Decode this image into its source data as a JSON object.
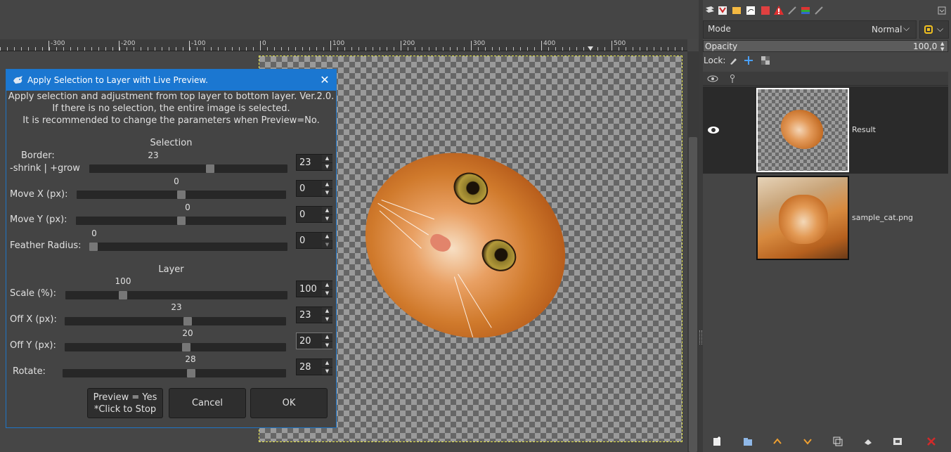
{
  "ruler": {
    "labels": [
      "-300",
      "-200",
      "-100",
      "0",
      "100",
      "200",
      "300",
      "400",
      "500"
    ]
  },
  "dialog": {
    "title": "Apply Selection to Layer with Live Preview.",
    "desc_line1": "Apply selection and adjustment from top layer to bottom layer. Ver.2.0.",
    "desc_line2": "If there is no selection, the entire image is selected.",
    "desc_line3": "It is recommended to change the parameters when Preview=No.",
    "section_selection": "Selection",
    "section_layer": "Layer",
    "params": {
      "border": {
        "label1": "Border:",
        "label2": "-shrink | +grow",
        "value": "23",
        "min": -100,
        "max": 100,
        "level": 23
      },
      "move_x": {
        "label": "Move X (px):",
        "value": "0",
        "min": -200,
        "max": 200,
        "level": 0
      },
      "move_y": {
        "label": "Move Y (px):",
        "value": "0",
        "min": -200,
        "max": 200,
        "level": 0
      },
      "feather": {
        "label": "Feather Radius:",
        "value": "0",
        "min": 0,
        "max": 100,
        "level": 0
      },
      "scale": {
        "label": "Scale (%):",
        "value": "100",
        "min": 0,
        "max": 400,
        "level": 100
      },
      "off_x": {
        "label": "Off X (px):",
        "value": "23",
        "min": -200,
        "max": 200,
        "level": 23
      },
      "off_y": {
        "label": "Off Y (px):",
        "value": "20",
        "min": -200,
        "max": 200,
        "level": 20
      },
      "rotate": {
        "label": "Rotate:",
        "value": "28",
        "min": -180,
        "max": 180,
        "level": 28
      }
    },
    "preview_button_line1": "Preview = Yes",
    "preview_button_line2": "*Click to Stop",
    "cancel_label": "Cancel",
    "ok_label": "OK",
    "close_glyph": "✕"
  },
  "layers_dock": {
    "mode_label": "Mode",
    "mode_value": "Normal",
    "opacity_label": "Opacity",
    "opacity_value": "100,0",
    "opacity_level": 100,
    "lock_label": "Lock:",
    "layers": [
      {
        "name": "Result",
        "visible": true,
        "selected": true
      },
      {
        "name": "sample_cat.png",
        "visible": false,
        "selected": false
      }
    ]
  },
  "colors": {
    "accent": "#1b77d1",
    "selection_border": "#e6e64a",
    "delete_icon": "#d22a2a"
  }
}
